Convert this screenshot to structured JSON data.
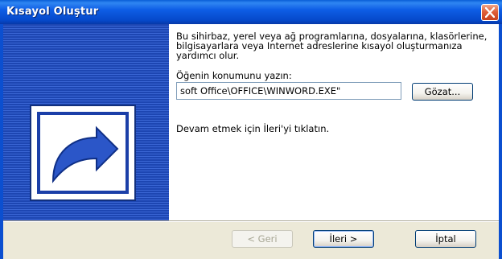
{
  "window": {
    "title": "Kısayol Oluştur"
  },
  "content": {
    "intro": "Bu sihirbaz, yerel veya ağ programlarına, dosyalarına, klasörlerine, bilgisayarlara veya Internet adreslerine kısayol oluşturmanıza yardımcı olur.",
    "location_label": "Öğenin konumunu yazın:",
    "location_value": "soft Office\\OFFICE\\WINWORD.EXE\"",
    "browse_label": "Gözat...",
    "hint": "Devam etmek için İleri'yi tıklatın."
  },
  "buttons": {
    "back": "< Geri",
    "next": "İleri >",
    "cancel": "İptal"
  },
  "icons": {
    "close": "close-icon",
    "shortcut": "shortcut-arrow-icon"
  },
  "colors": {
    "titlebar": "#0b4fd0",
    "side_panel": "#1d46b2",
    "close_button": "#d9542d"
  }
}
